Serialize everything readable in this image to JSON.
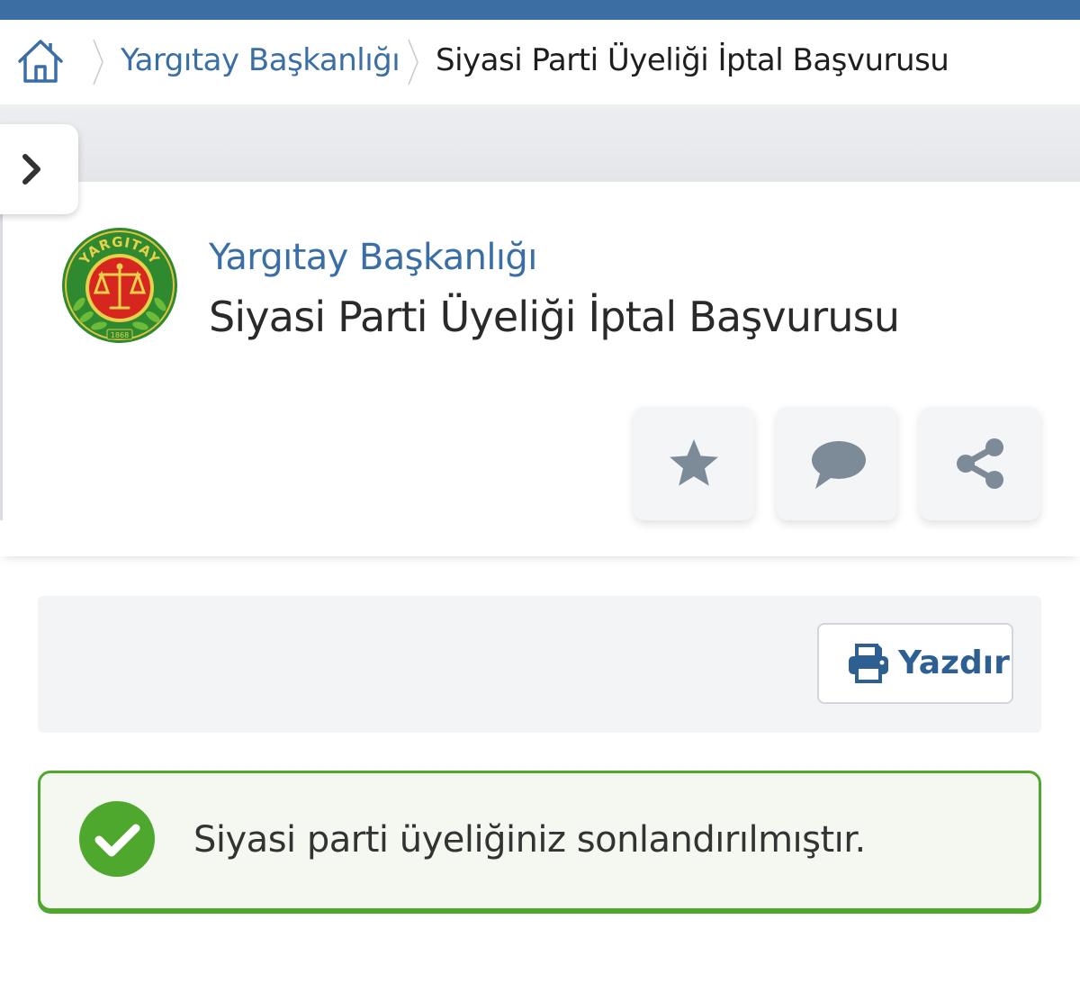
{
  "breadcrumb": {
    "home_icon": "home-icon",
    "items": [
      {
        "label": "Yargıtay Başkanlığı"
      },
      {
        "label": "Siyasi Parti Üyeliği İptal Başvurusu"
      }
    ]
  },
  "header": {
    "agency": "Yargıtay Başkanlığı",
    "title": "Siyasi Parti Üyeliği İptal Başvurusu",
    "logo": {
      "text_top": "YARGITAY",
      "text_bottom": "1868"
    }
  },
  "actions": [
    {
      "icon": "star-icon"
    },
    {
      "icon": "comment-icon"
    },
    {
      "icon": "share-icon"
    }
  ],
  "toolbar": {
    "print_label": "Yazdır",
    "print_icon": "printer-icon"
  },
  "alert": {
    "message": "Siyasi parti üyeliğiniz sonlandırılmıştır.",
    "icon": "check-circle-icon"
  },
  "colors": {
    "accent": "#3d6ea3",
    "link": "#3a6ea6",
    "success": "#4fa82e",
    "icon_gray": "#8a9aa8"
  }
}
